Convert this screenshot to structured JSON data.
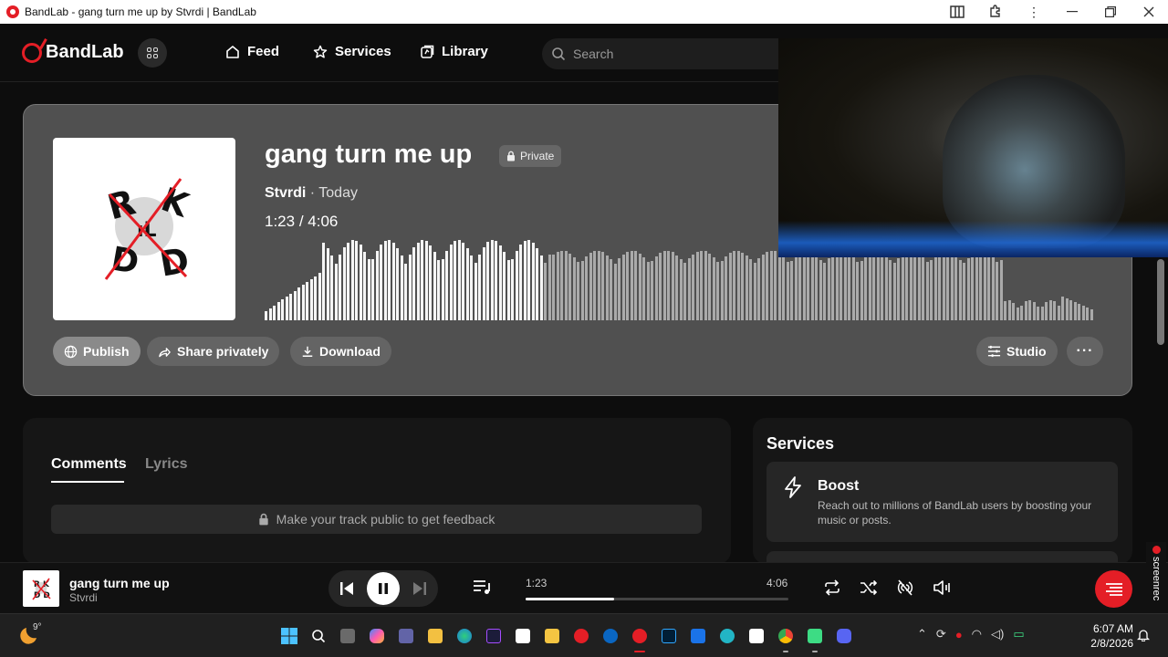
{
  "window": {
    "title": "BandLab - gang turn me up by Stvrdi | BandLab"
  },
  "nav": {
    "logo": "BandLab",
    "links": [
      {
        "label": "Feed",
        "icon": "home-icon"
      },
      {
        "label": "Services",
        "icon": "star-icon"
      },
      {
        "label": "Library",
        "icon": "library-icon"
      }
    ],
    "search_placeholder": "Search"
  },
  "track": {
    "title": "gang turn me up",
    "privacy_badge": "Private",
    "artist": "Stvrdi",
    "date": "· Today",
    "current_time": "1:23",
    "separator": " / ",
    "duration": "4:06",
    "progress_fraction": 0.337,
    "actions": {
      "publish": "Publish",
      "share": "Share privately",
      "download": "Download",
      "studio": "Studio",
      "more": "···"
    }
  },
  "comments_panel": {
    "tabs": [
      "Comments",
      "Lyrics"
    ],
    "active_tab": "Comments",
    "notice": "Make your track public to get feedback"
  },
  "services_panel": {
    "title": "Services",
    "items": [
      {
        "name": "Boost",
        "icon": "lightning-icon",
        "description": "Reach out to millions of BandLab users by boosting your music or posts."
      }
    ]
  },
  "player": {
    "title": "gang turn me up",
    "artist": "Stvrdi",
    "current_time": "1:23",
    "duration": "4:06",
    "progress_fraction": 0.337
  },
  "overlay": {
    "recorder_label": "screenrec"
  },
  "taskbar": {
    "temperature": "9°",
    "time": "6:07 AM",
    "date": "2/8/2026"
  },
  "colors": {
    "brand": "#e41e26",
    "card": "#505050",
    "background": "#0d0d0d"
  }
}
